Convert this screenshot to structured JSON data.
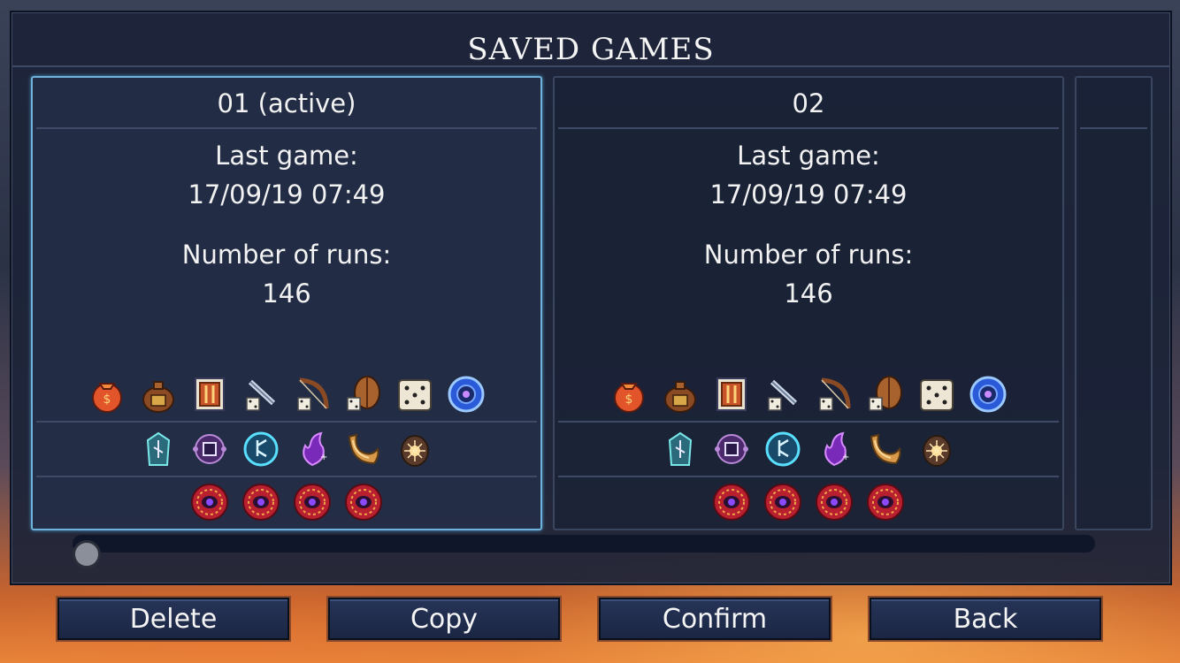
{
  "title": "SAVED GAMES",
  "slots": [
    {
      "name": "01 (active)",
      "last_game_label": "Last game:",
      "last_game_value": "17/09/19 07:49",
      "runs_label": "Number of runs:",
      "runs_value": "146"
    },
    {
      "name": "02",
      "last_game_label": "Last game:",
      "last_game_value": "17/09/19 07:49",
      "runs_label": "Number of runs:",
      "runs_value": "146"
    }
  ],
  "icons": {
    "row1": [
      "gold-sack-icon",
      "money-bag-icon",
      "level-card-icon",
      "blade-dice-icon",
      "bow-dice-icon",
      "shield-dice-icon",
      "dice-icon",
      "blue-orb-icon"
    ],
    "row2": [
      "rune-stone-icon",
      "purple-gear-icon",
      "cyan-rune-icon",
      "purple-flame-icon",
      "horn-icon",
      "spider-orb-icon"
    ],
    "row3": [
      "red-eye-medallion-icon",
      "red-eye-medallion-icon",
      "red-eye-medallion-icon",
      "red-eye-medallion-icon"
    ]
  },
  "scroll_progress": 0,
  "buttons": {
    "delete": "Delete",
    "copy": "Copy",
    "confirm": "Confirm",
    "back": "Back"
  },
  "colors": {
    "active_border": "#6fb2dc",
    "panel_bg": "#1c2438",
    "button_bg": "#1f2b4c"
  }
}
